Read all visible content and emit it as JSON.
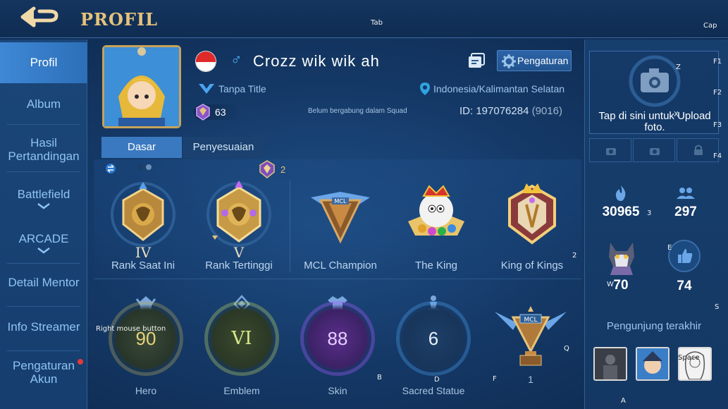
{
  "header": {
    "title": "PROFIL"
  },
  "key_hints": {
    "tab": "Tab",
    "cap": "Cap",
    "f1": "F1",
    "f2": "F2",
    "f3": "F3",
    "f4": "F4",
    "z": "Z",
    "x": "X",
    "e": "E",
    "w": "W",
    "s": "S",
    "q": "Q",
    "b": "B",
    "d": "D",
    "f": "F",
    "a": "A",
    "two_a": "2",
    "three": "3",
    "space": "Space",
    "rmb": "Right mouse button"
  },
  "sidebar": {
    "items": [
      {
        "label": "Profil",
        "active": true
      },
      {
        "label": "Album"
      },
      {
        "label": "Hasil Pertandingan"
      },
      {
        "label": "Battlefield"
      },
      {
        "label": "ARCADE"
      },
      {
        "label": "Detail Mentor"
      },
      {
        "label": "Info Streamer"
      },
      {
        "label": "Pengaturan Akun",
        "badge": true
      }
    ]
  },
  "profile": {
    "name": "Crozz wik wik ah",
    "gender_symbol": "♂",
    "title": "Tanpa Title",
    "location": "Indonesia/Kalimantan Selatan",
    "level": "63",
    "squad_status": "Belum bergabung dalam Squad",
    "id_label": "ID:",
    "id": "197076284",
    "server": "(9016)",
    "settings_label": "Pengaturan"
  },
  "tabs": [
    {
      "label": "Dasar",
      "active": true
    },
    {
      "label": "Penyesuaian"
    }
  ],
  "ranks": {
    "season_count": "2",
    "items": [
      {
        "label": "Rank Saat Ini",
        "tier": "IV"
      },
      {
        "label": "Rank Tertinggi",
        "tier": "V"
      },
      {
        "label": "MCL Champion",
        "tier": ""
      },
      {
        "label": "The King",
        "tier": ""
      },
      {
        "label": "King of Kings",
        "tier": ""
      }
    ]
  },
  "stats": [
    {
      "label": "Hero",
      "value": "90"
    },
    {
      "label": "Emblem",
      "value": "VI"
    },
    {
      "label": "Skin",
      "value": "88"
    },
    {
      "label": "Sacred Statue",
      "value": "6"
    },
    {
      "label": "1",
      "value": ""
    }
  ],
  "right_panel": {
    "upload_text": "Tap di sini untuk Upload foto.",
    "popularity": "30965",
    "followers": "297",
    "pet_level": "70",
    "likes": "74",
    "recent_visitors_title": "Pengunjung terakhir"
  },
  "colors": {
    "accent_gold": "#e6c27a",
    "active_blue": "#3a79bf",
    "text_light_blue": "#8ec3f2",
    "hero_ring": "#e6d27a",
    "emblem_ring": "#cbe07a",
    "skin_ring": "#a85cff",
    "statue_ring": "#4a9ee8"
  }
}
